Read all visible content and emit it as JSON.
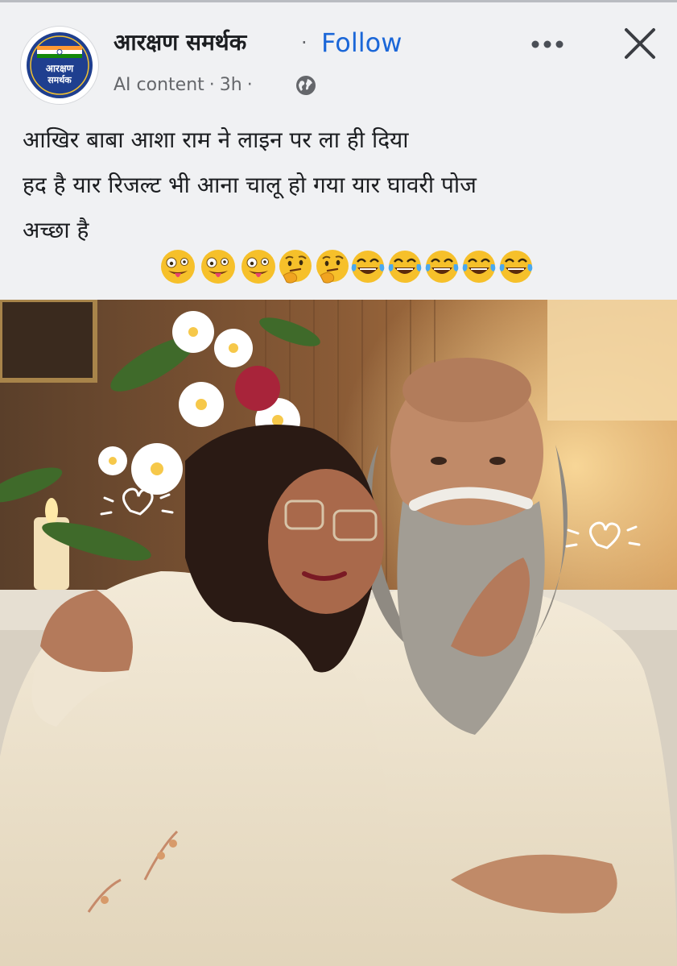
{
  "post": {
    "page_name": "आरक्षण समर्थक",
    "separator": "·",
    "follow_label": "Follow",
    "label": "AI content",
    "time": "3h",
    "avatar_text": "आरक्षण समर्थक",
    "text_lines": [
      "आखिर बाबा आशा राम ने लाइन पर ला ही दिया",
      "हद है यार रिजल्ट भी आना चालू हो गया यार घावरी पोज",
      "अच्छा है"
    ],
    "emojis": [
      "zany-face",
      "zany-face",
      "zany-face",
      "thinking-face",
      "thinking-face",
      "tears-of-joy-face",
      "tears-of-joy-face",
      "tears-of-joy-face",
      "tears-of-joy-face",
      "tears-of-joy-face"
    ]
  },
  "icons": {
    "more": "more-horizontal-icon",
    "close": "close-icon",
    "privacy": "globe-icon"
  },
  "colors": {
    "background": "#f0f1f3",
    "follow_blue": "#1b67d8",
    "meta_gray": "#65676b",
    "avatar_navy": "#1f3f8f"
  }
}
